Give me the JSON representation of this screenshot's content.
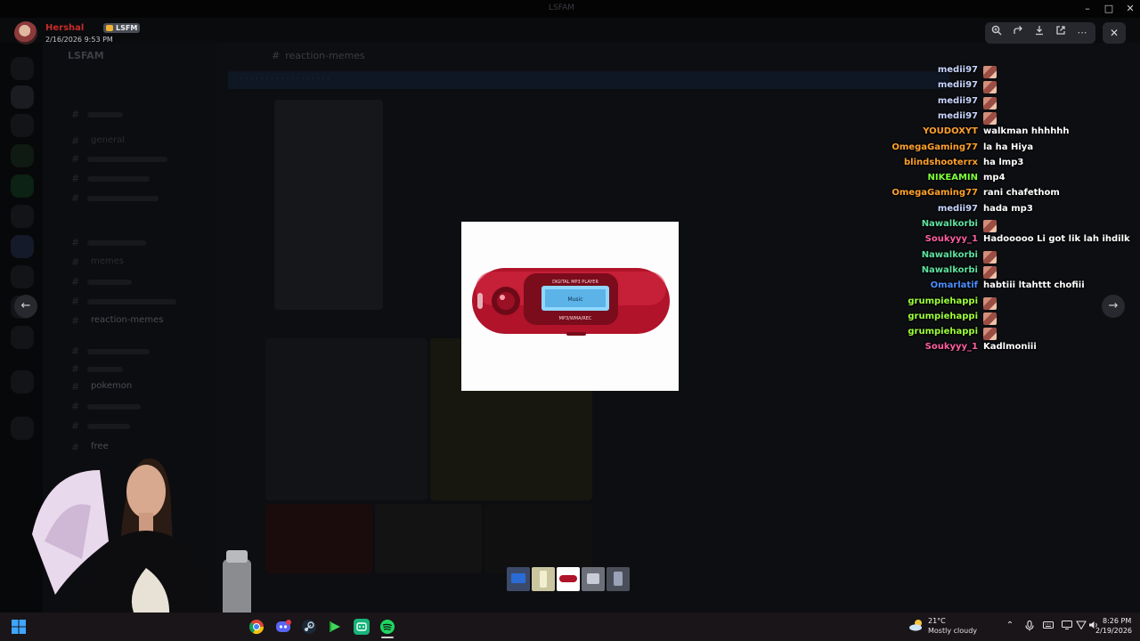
{
  "window": {
    "title": "LSFAM"
  },
  "viewer": {
    "author": "Hershal",
    "author_tag": "LSFM",
    "timestamp": "2/16/2026 9:53 PM",
    "image_alt": "DIGITAL MP3 PLAYER",
    "player_label": "DIGITAL MP3 PLAYER",
    "player_format": "MP3/WMA/REC",
    "player_screen": "Music",
    "thumbnail_count": 5,
    "selected_thumbnail": 3
  },
  "discord_background": {
    "server_name": "LSFAM",
    "channel": "reaction-memes",
    "channels": [
      "general",
      "memes",
      "reaction-memes",
      "pokemon",
      "free"
    ]
  },
  "chat": [
    {
      "user": "medii97",
      "color": "#c9d5ff",
      "message": "",
      "emote": true
    },
    {
      "user": "medii97",
      "color": "#c9d5ff",
      "message": "",
      "emote": true
    },
    {
      "user": "medii97",
      "color": "#c9d5ff",
      "message": "",
      "emote": true
    },
    {
      "user": "medii97",
      "color": "#c9d5ff",
      "message": "",
      "emote": true
    },
    {
      "user": "YOUDOXYT",
      "color": "#ffa12b",
      "message": "walkman hhhhhh",
      "emote": false
    },
    {
      "user": "OmegaGaming77",
      "color": "#ffa12b",
      "message": "la ha Hiya",
      "emote": false
    },
    {
      "user": "blindshooterrx",
      "color": "#ffa12b",
      "message": "ha lmp3",
      "emote": false
    },
    {
      "user": "NIKEAMIN",
      "color": "#7fff3a",
      "message": "mp4",
      "emote": false
    },
    {
      "user": "OmegaGaming77",
      "color": "#ffa12b",
      "message": "rani chafethom",
      "emote": false
    },
    {
      "user": "medii97",
      "color": "#c9d5ff",
      "message": "hada mp3",
      "emote": false
    },
    {
      "user": "Nawalkorbi",
      "color": "#5fe0a0",
      "message": "",
      "emote": true
    },
    {
      "user": "Soukyyy_1",
      "color": "#ff5fa2",
      "message": "Hadooooo Li got lik lah ihdilk",
      "emote": false
    },
    {
      "user": "Nawalkorbi",
      "color": "#5fe0a0",
      "message": "",
      "emote": true
    },
    {
      "user": "Nawalkorbi",
      "color": "#5fe0a0",
      "message": "",
      "emote": true
    },
    {
      "user": "Omarlatif",
      "color": "#4a8dff",
      "message": "habtiii ltahttt chofiii",
      "emote": false
    },
    {
      "user": "grumpiehappi",
      "color": "#9dff3a",
      "message": "",
      "emote": true
    },
    {
      "user": "grumpiehappi",
      "color": "#9dff3a",
      "message": "",
      "emote": true
    },
    {
      "user": "grumpiehappi",
      "color": "#9dff3a",
      "message": "",
      "emote": true
    },
    {
      "user": "Soukyyy_1",
      "color": "#ff5fa2",
      "message": "Kadlmoniii",
      "emote": false
    }
  ],
  "taskbar": {
    "temperature": "21°C",
    "weather": "Mostly cloudy",
    "time": "8:26 PM",
    "date": "2/19/2026"
  },
  "icons": [
    "zoom-icon",
    "forward-icon",
    "download-icon",
    "open-external-icon",
    "more-icon",
    "close-icon",
    "arrow-left-icon",
    "arrow-right-icon"
  ]
}
